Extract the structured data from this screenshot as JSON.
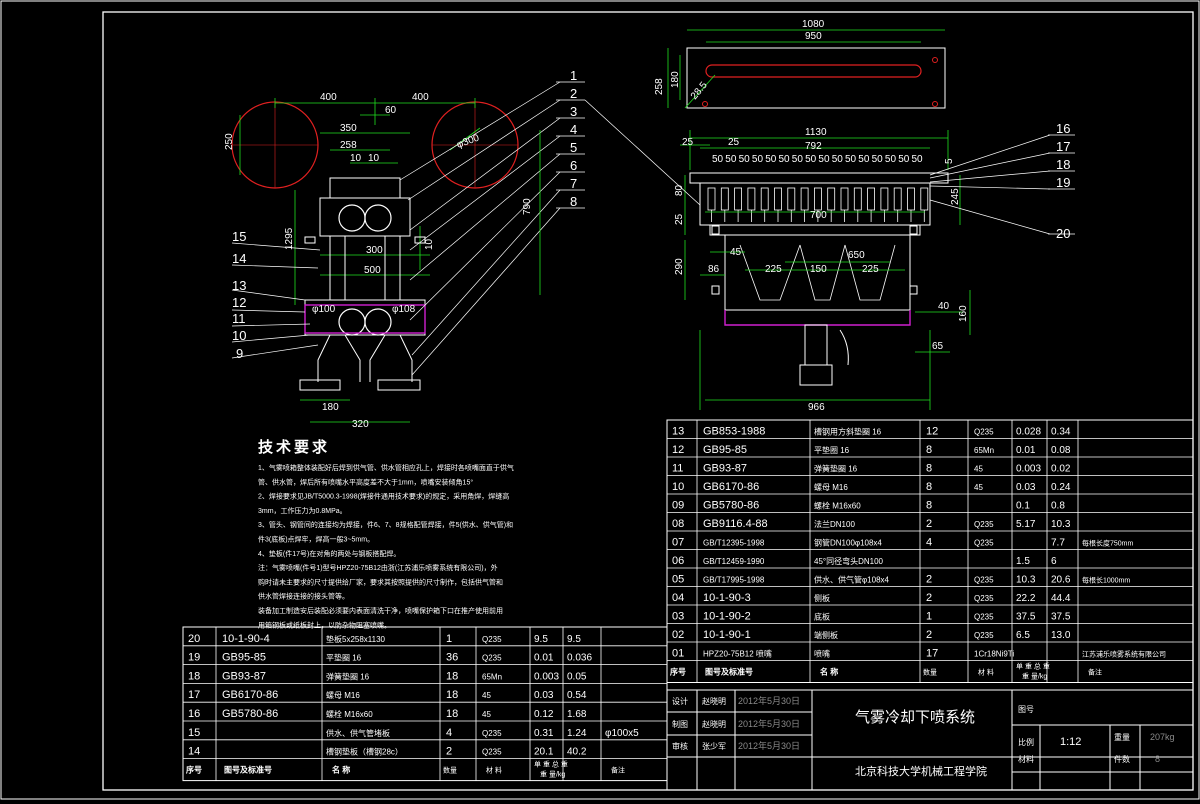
{
  "drawing": {
    "title": "气雾冷却下喷系统",
    "institution": "北京科技大学机械工程学院",
    "scale": "1:12",
    "weight": "207kg",
    "sheet": "8",
    "date": "2012年5月30日"
  },
  "tech_requirements": {
    "heading": "技术要求",
    "lines": [
      "1、气雾喷箱整体装配好后焊到供气管、供水管相应孔上，焊接时各喷嘴面直于供气",
      "管、供水管，焊后所有喷嘴水平高度差不大于1mm，喷嘴安装倾角15°",
      "2、焊接要求见JB/T5000.3-1998(焊接件通用技术要求)的规定，采用角焊，焊缝高",
      "3mm，工作压力为0.8MPa。",
      "3、管头、钢管间的连接均为焊接，件6、7、8规格配管焊接，件5(供水、供气管)和",
      "件3(底板)点焊牢，焊高一般3~5mm。",
      "4、垫板(件17号)在对角的两处与钢板搭配焊。",
      "注：气雾喷嘴(件号1)型号HPZ20-75B12由浙(江苏浦乐喷雾系统有限公司)，外",
      "购时请未主要求的尺寸提供给厂家，要求其按照提供的尺寸制作，包括供气管和",
      "供水管焊接连接的接头管等。",
      "     装备加工制造安后装配必须要内表面清洗干净，喷嘴保护箱下口在推产使用前用",
      "用箱钢板或纸板封上，以防杂物阻塞喷嘴。"
    ]
  },
  "dims_left": [
    "400",
    "400",
    "60",
    "350",
    "258",
    "10",
    "10",
    "250",
    "1295",
    "300",
    "500",
    "10",
    "790",
    "φ100",
    "φ108",
    "180",
    "320",
    "φ300"
  ],
  "dims_right": [
    "1080",
    "950",
    "258",
    "180",
    "28.5",
    "1130",
    "792",
    "25",
    "25",
    "80",
    "25",
    "700",
    "245",
    "45",
    "225",
    "150",
    "650",
    "225",
    "290",
    "86",
    "40",
    "160",
    "65",
    "966",
    "5",
    "50"
  ],
  "callouts_left": [
    "1",
    "2",
    "3",
    "4",
    "5",
    "6",
    "7",
    "8",
    "15",
    "14",
    "13",
    "12",
    "11",
    "10",
    "9"
  ],
  "callouts_right": [
    "16",
    "17",
    "18",
    "19",
    "20"
  ],
  "bom_right": {
    "rows": [
      {
        "no": "13",
        "code": "GB853-1988",
        "name": "槽钢用方斜垫圈  16",
        "qty": "12",
        "mat": "Q235",
        "unit": "0.028",
        "total": "0.34",
        "note": ""
      },
      {
        "no": "12",
        "code": "GB95-85",
        "name": "平垫圈  16",
        "qty": "8",
        "mat": "65Mn",
        "unit": "0.01",
        "total": "0.08",
        "note": ""
      },
      {
        "no": "11",
        "code": "GB93-87",
        "name": "弹簧垫圈  16",
        "qty": "8",
        "mat": "45",
        "unit": "0.003",
        "total": "0.02",
        "note": ""
      },
      {
        "no": "10",
        "code": "GB6170-86",
        "name": "螺母  M16",
        "qty": "8",
        "mat": "45",
        "unit": "0.03",
        "total": "0.24",
        "note": ""
      },
      {
        "no": "09",
        "code": "GB5780-86",
        "name": "螺栓  M16x60",
        "qty": "8",
        "mat": "",
        "unit": "0.1",
        "total": "0.8",
        "note": ""
      },
      {
        "no": "08",
        "code": "GB9116.4-88",
        "name": "法兰DN100",
        "qty": "2",
        "mat": "Q235",
        "unit": "5.17",
        "total": "10.3",
        "note": ""
      },
      {
        "no": "07",
        "code": "GB/T12395-1998",
        "name": "钢管DN100φ108x4",
        "qty": "4",
        "mat": "Q235",
        "unit": "",
        "total": "7.7",
        "note": "每根长度750mm"
      },
      {
        "no": "06",
        "code": "GB/T12459-1990",
        "name": "45°同径弯头DN100",
        "qty": "",
        "mat": "",
        "unit": "1.5",
        "total": "6",
        "note": ""
      },
      {
        "no": "05",
        "code": "GB/T17995-1998",
        "name": "供水、供气管φ108x4",
        "qty": "2",
        "mat": "Q235",
        "unit": "10.3",
        "total": "20.6",
        "note": "每根长1000mm"
      },
      {
        "no": "04",
        "code": "10-1-90-3",
        "name": "侧板",
        "qty": "2",
        "mat": "Q235",
        "unit": "22.2",
        "total": "44.4",
        "note": ""
      },
      {
        "no": "03",
        "code": "10-1-90-2",
        "name": "底板",
        "qty": "1",
        "mat": "Q235",
        "unit": "37.5",
        "total": "37.5",
        "note": ""
      },
      {
        "no": "02",
        "code": "10-1-90-1",
        "name": "端侧板",
        "qty": "2",
        "mat": "Q235",
        "unit": "6.5",
        "total": "13.0",
        "note": ""
      },
      {
        "no": "01",
        "code": "HPZ20-75B12 喷嘴",
        "name": "喷嘴",
        "qty": "17",
        "mat": "1Cr18Ni9Ti",
        "unit": "",
        "total": "",
        "note": "江苏浦乐喷雾系统有限公司"
      }
    ],
    "header": {
      "no": "序号",
      "code": "图号及标准号",
      "name": "名    称",
      "qty": "数量",
      "mat": "材    料",
      "weight": "单  重  总  重",
      "weight_unit": "重 量/kg",
      "note": "备注"
    }
  },
  "bom_left": {
    "rows": [
      {
        "no": "20",
        "code": "10-1-90-4",
        "name": "垫板5x258x1130",
        "qty": "1",
        "mat": "Q235",
        "unit": "9.5",
        "total": "9.5",
        "note": ""
      },
      {
        "no": "19",
        "code": "GB95-85",
        "name": "平垫圈  16",
        "qty": "36",
        "mat": "Q235",
        "unit": "0.01",
        "total": "0.036",
        "note": ""
      },
      {
        "no": "18",
        "code": "GB93-87",
        "name": "弹簧垫圈  16",
        "qty": "18",
        "mat": "65Mn",
        "unit": "0.003",
        "total": "0.05",
        "note": ""
      },
      {
        "no": "17",
        "code": "GB6170-86",
        "name": "螺母  M16",
        "qty": "18",
        "mat": "45",
        "unit": "0.03",
        "total": "0.54",
        "note": ""
      },
      {
        "no": "16",
        "code": "GB5780-86",
        "name": "螺栓  M16x60",
        "qty": "18",
        "mat": "45",
        "unit": "0.12",
        "total": "1.68",
        "note": ""
      },
      {
        "no": "15",
        "code": "",
        "name": "供水、供气管堵板",
        "qty": "4",
        "mat": "Q235",
        "unit": "0.31",
        "total": "1.24",
        "note": "φ100x5"
      },
      {
        "no": "14",
        "code": "",
        "name": "槽钢垫板（槽钢28c）",
        "qty": "2",
        "mat": "Q235",
        "unit": "20.1",
        "total": "40.2",
        "note": ""
      }
    ],
    "header": {
      "no": "序号",
      "code": "图号及标准号",
      "name": "名    称",
      "qty": "数量",
      "mat": "材    料",
      "weight": "单  重  总  重",
      "weight_unit": "重 量/kg",
      "note": "备注"
    }
  },
  "title_block": {
    "roles": [
      "设计",
      "制图",
      "审核"
    ],
    "names": [
      "赵晓明",
      "赵晓明",
      "张少军"
    ],
    "dates": [
      "2012年5月30日",
      "2012年5月30日",
      "2012年5月30日"
    ],
    "labels": {
      "drawing_no": "图号",
      "scale": "比例",
      "weight": "重量",
      "material": "材料",
      "sheet": "件数"
    }
  }
}
